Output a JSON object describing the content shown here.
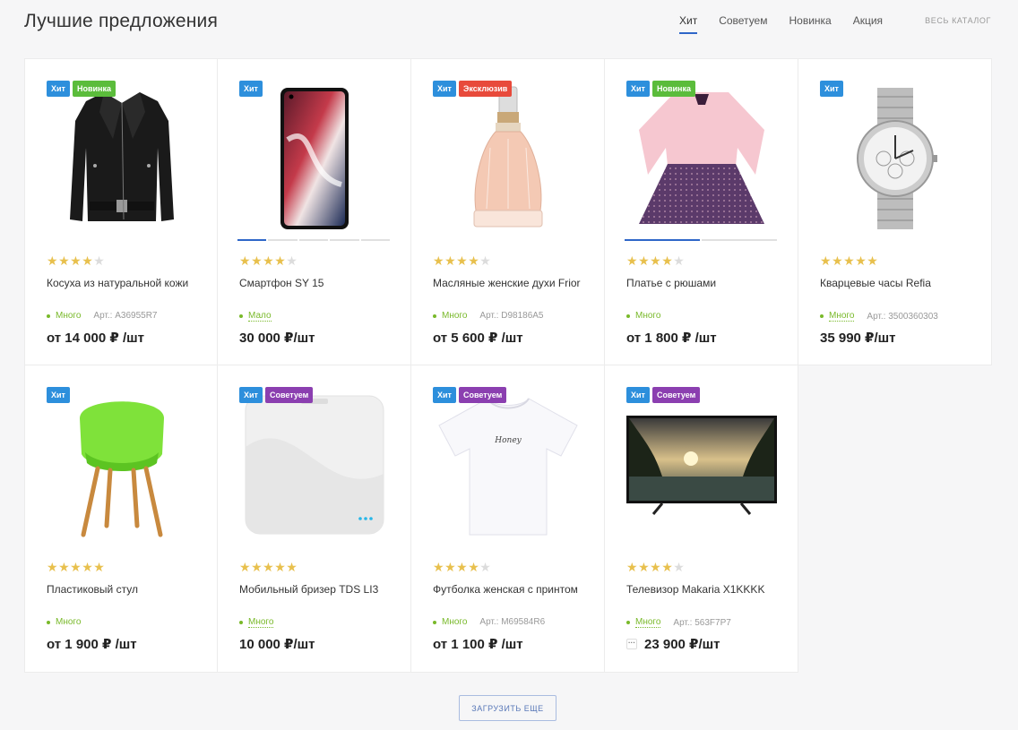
{
  "header": {
    "title": "Лучшие предложения",
    "tabs": [
      {
        "label": "Хит",
        "active": true
      },
      {
        "label": "Советуем",
        "active": false
      },
      {
        "label": "Новинка",
        "active": false
      },
      {
        "label": "Акция",
        "active": false
      }
    ],
    "catalog_link": "ВЕСЬ КАТАЛОГ"
  },
  "colors": {
    "hit": "#2d8fdc",
    "new": "#5bbc3b",
    "exclusive": "#e84a3b",
    "recommend": "#8b3fb0",
    "accent": "#2e66c8",
    "stock": "#79b92a",
    "star": "#e8c04d"
  },
  "products": [
    {
      "name": "Косуха из натуральной кожи",
      "image_icon": "leather-jacket",
      "badges": [
        {
          "label": "Хит",
          "type": "hit"
        },
        {
          "label": "Новинка",
          "type": "new"
        }
      ],
      "rating": 4,
      "stock": "Много",
      "stock_dotted": false,
      "sku": "Арт.: A36955R7",
      "price": "от 14 000 ₽ /шт",
      "slider": null
    },
    {
      "name": "Смартфон SY 15",
      "image_icon": "smartphone",
      "badges": [
        {
          "label": "Хит",
          "type": "hit"
        }
      ],
      "rating": 4,
      "stock": "Мало",
      "stock_dotted": true,
      "sku": "",
      "price": "30 000 ₽/шт",
      "slider": {
        "count": 5,
        "active": 0
      }
    },
    {
      "name": "Масляные женские духи Frior",
      "image_icon": "perfume-bottle",
      "badges": [
        {
          "label": "Хит",
          "type": "hit"
        },
        {
          "label": "Эксклюзив",
          "type": "exclusive"
        }
      ],
      "rating": 4,
      "stock": "Много",
      "stock_dotted": false,
      "sku": "Арт.: D98186A5",
      "price": "от 5 600 ₽ /шт",
      "slider": null
    },
    {
      "name": "Платье с рюшами",
      "image_icon": "dress",
      "badges": [
        {
          "label": "Хит",
          "type": "hit"
        },
        {
          "label": "Новинка",
          "type": "new"
        }
      ],
      "rating": 4,
      "stock": "Много",
      "stock_dotted": false,
      "sku": "",
      "price": "от 1 800 ₽ /шт",
      "slider": {
        "count": 2,
        "active": 0
      }
    },
    {
      "name": "Кварцевые часы Refia",
      "image_icon": "wristwatch",
      "badges": [
        {
          "label": "Хит",
          "type": "hit"
        }
      ],
      "rating": 5,
      "stock": "Много",
      "stock_dotted": true,
      "sku": "Арт.: 3500360303",
      "price": "35 990 ₽/шт",
      "slider": null
    },
    {
      "name": "Пластиковый стул",
      "image_icon": "chair",
      "badges": [
        {
          "label": "Хит",
          "type": "hit"
        }
      ],
      "rating": 5,
      "stock": "Много",
      "stock_dotted": false,
      "sku": "",
      "price": "от 1 900 ₽ /шт",
      "slider": null
    },
    {
      "name": "Мобильный бризер TDS LI3",
      "image_icon": "air-purifier",
      "badges": [
        {
          "label": "Хит",
          "type": "hit"
        },
        {
          "label": "Советуем",
          "type": "recommend"
        }
      ],
      "rating": 5,
      "stock": "Много",
      "stock_dotted": true,
      "sku": "",
      "price": "10 000 ₽/шт",
      "slider": null
    },
    {
      "name": "Футболка женская с принтом",
      "image_icon": "t-shirt",
      "badges": [
        {
          "label": "Хит",
          "type": "hit"
        },
        {
          "label": "Советуем",
          "type": "recommend"
        }
      ],
      "rating": 4,
      "stock": "Много",
      "stock_dotted": false,
      "sku": "Арт.: M69584R6",
      "price": "от 1 100 ₽ /шт",
      "slider": null
    },
    {
      "name": "Телевизор Makaria X1KKKK",
      "image_icon": "tv",
      "badges": [
        {
          "label": "Хит",
          "type": "hit"
        },
        {
          "label": "Советуем",
          "type": "recommend"
        }
      ],
      "rating": 4,
      "stock": "Много",
      "stock_dotted": true,
      "sku": "Арт.: 563F7P7",
      "price": "23 900 ₽/шт",
      "price_more": "···",
      "slider": null
    }
  ],
  "load_more": "ЗАГРУЗИТЬ ЕЩЕ"
}
